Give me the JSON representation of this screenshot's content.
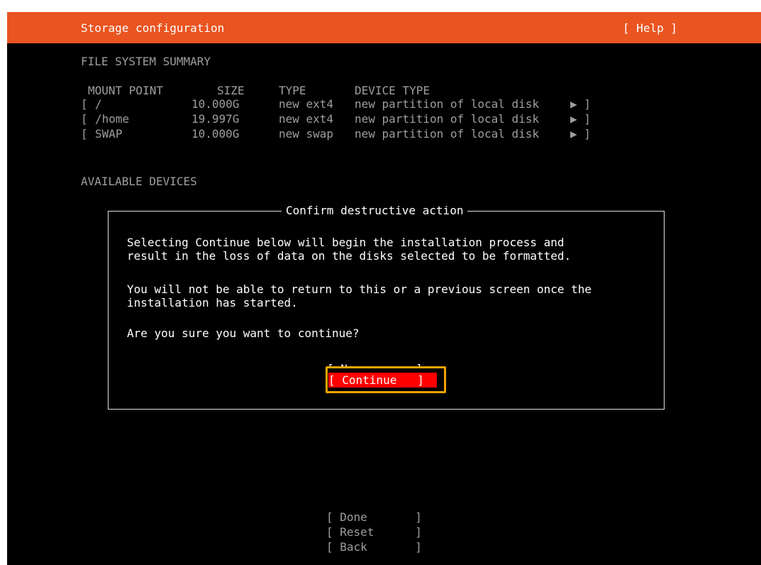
{
  "header": {
    "title": "Storage configuration",
    "help_label": "[ Help ]"
  },
  "summary": {
    "heading": "FILE SYSTEM SUMMARY",
    "columns": [
      "MOUNT POINT",
      "SIZE",
      "TYPE",
      "DEVICE TYPE"
    ],
    "rows": [
      {
        "open": "[",
        "mount": "/",
        "size": "10.000G",
        "type": "new ext4",
        "device": "new partition of local disk",
        "arrow": "▶ ]"
      },
      {
        "open": "[",
        "mount": "/home",
        "size": "19.997G",
        "type": "new ext4",
        "device": "new partition of local disk",
        "arrow": "▶ ]"
      },
      {
        "open": "[",
        "mount": "SWAP",
        "size": "10.000G",
        "type": "new swap",
        "device": "new partition of local disk",
        "arrow": "▶ ]"
      }
    ]
  },
  "devices": {
    "heading": "AVAILABLE DEVICES"
  },
  "dialog": {
    "title": "Confirm destructive action",
    "line1": "Selecting Continue below will begin the installation process and",
    "line2": "result in the loss of data on the disks selected to be formatted.",
    "line3": "You will not be able to return to this or a previous screen once the",
    "line4": "installation has started.",
    "line5": "Are you sure you want to continue?",
    "no_label": "[ No         ]",
    "continue_label": "[ Continue   ]"
  },
  "footer": {
    "done_label": "[ Done       ]",
    "reset_label": "[ Reset      ]",
    "back_label": "[ Back       ]"
  },
  "colors": {
    "accent": "#e95420",
    "selected_button": "#ff0000",
    "highlight_outline": "#f0a400"
  }
}
